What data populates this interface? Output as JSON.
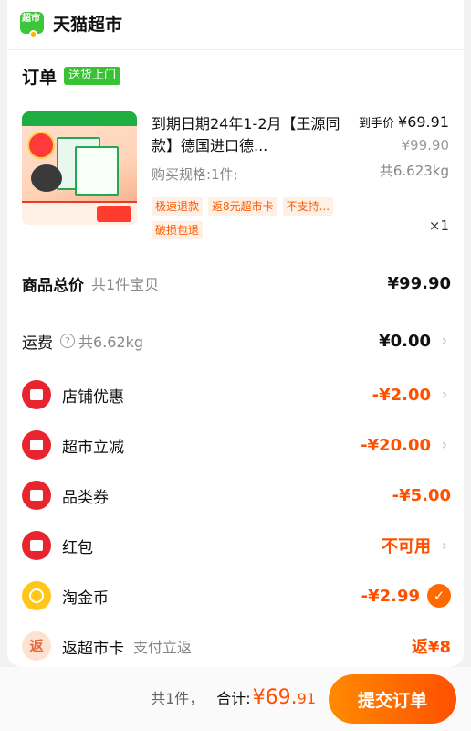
{
  "header": {
    "logo_text": "超市",
    "store_name": "天猫超市"
  },
  "order": {
    "title": "订单",
    "delivery_tag": "送货上门"
  },
  "product": {
    "title": "到期日期24年1-2月【王源同款】德国进口德...",
    "spec": "购买规格:1件;",
    "hand_label": "到手价",
    "hand_price": "¥69.91",
    "original_price": "¥99.90",
    "weight": "共6.623kg",
    "tags": [
      "极速退款",
      "返8元超市卡",
      "不支持...",
      "破损包退"
    ],
    "quantity": "×1"
  },
  "summary": {
    "total_label": "商品总价",
    "total_sub": "共1件宝贝",
    "total_value": "¥99.90",
    "shipping_label": "运费",
    "shipping_sub": "共6.62kg",
    "shipping_value": "¥0.00",
    "shop_discount_label": "店铺优惠",
    "shop_discount_value": "-¥2.00",
    "market_discount_label": "超市立减",
    "market_discount_value": "-¥20.00",
    "category_coupon_label": "品类券",
    "category_coupon_value": "-¥5.00",
    "red_packet_label": "红包",
    "red_packet_value": "不可用",
    "gold_coin_label": "淘金币",
    "gold_coin_value": "-¥2.99",
    "rebate_label": "返超市卡",
    "rebate_sub": "支付立返",
    "rebate_value": "返¥8",
    "rebate_glyph": "返"
  },
  "footer": {
    "count": "共1件，",
    "total_label": "合计:",
    "total_main": "¥69.",
    "total_decimal": "91",
    "submit_label": "提交订单"
  },
  "colors": {
    "accent": "#ff5000",
    "green": "#39c234",
    "coupon_red": "#e8252f",
    "coin_gold": "#ffc71c"
  },
  "icons": [
    "tmall-market-logo",
    "help-icon",
    "ticket-icon",
    "coupon-icon",
    "red-packet-icon",
    "gold-coin-icon",
    "rebate-icon",
    "chevron-right-icon",
    "check-icon"
  ]
}
